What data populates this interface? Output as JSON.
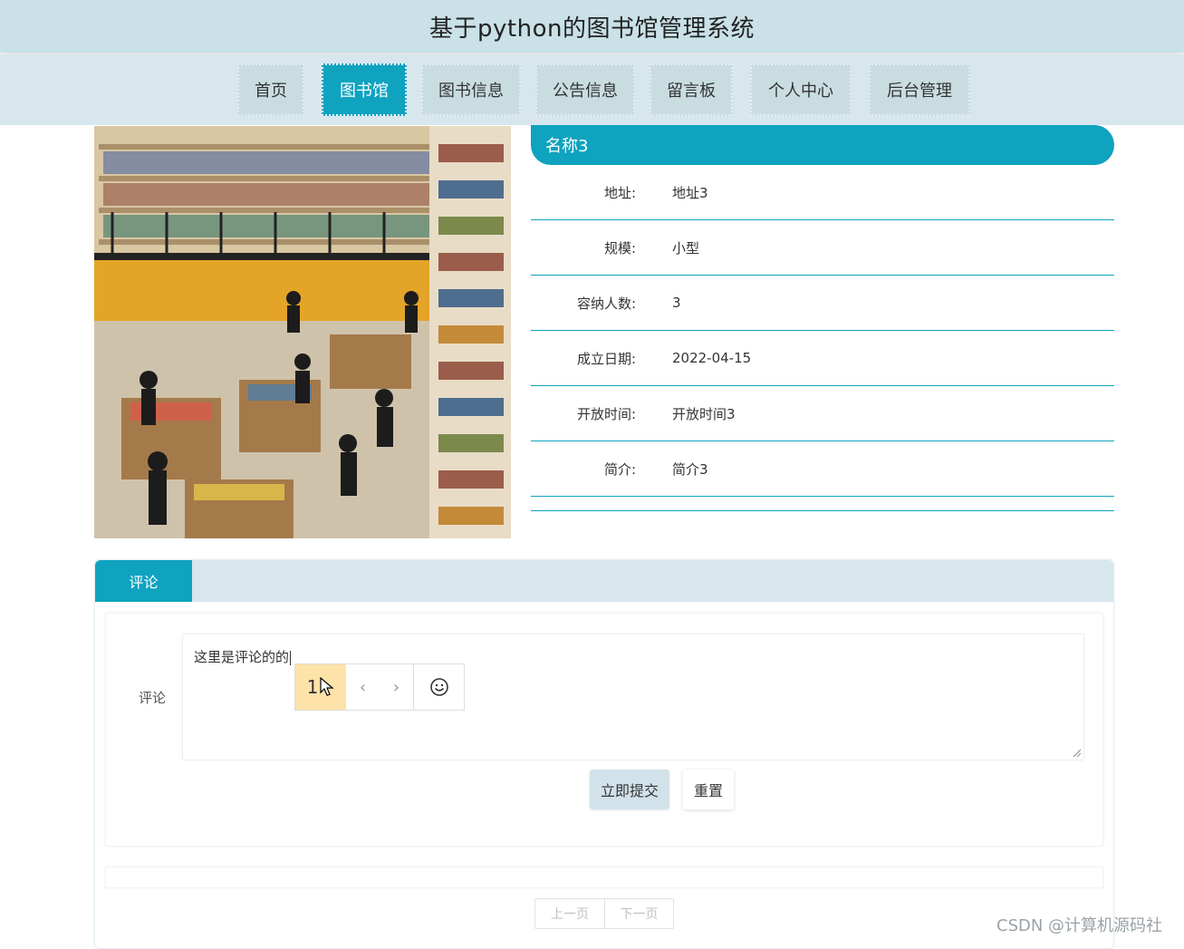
{
  "header": {
    "title": "基于python的图书馆管理系统"
  },
  "nav": {
    "items": [
      {
        "label": "首页",
        "active": false
      },
      {
        "label": "图书馆",
        "active": true
      },
      {
        "label": "图书信息",
        "active": false
      },
      {
        "label": "公告信息",
        "active": false
      },
      {
        "label": "留言板",
        "active": false
      },
      {
        "label": "个人中心",
        "active": false
      },
      {
        "label": "后台管理",
        "active": false
      }
    ]
  },
  "detail": {
    "name": "名称3",
    "fields": [
      {
        "label": "地址:",
        "value": "地址3"
      },
      {
        "label": "规模:",
        "value": "小型"
      },
      {
        "label": "容纳人数:",
        "value": "3"
      },
      {
        "label": "成立日期:",
        "value": "2022-04-15"
      },
      {
        "label": "开放时间:",
        "value": "开放时间3"
      },
      {
        "label": "简介:",
        "value": "简介3"
      }
    ]
  },
  "comments": {
    "tab_label": "评论",
    "form_label": "评论",
    "textarea_value": "这里是评论的的",
    "ime": {
      "candidate": "1",
      "prev": "‹",
      "next": "›"
    },
    "submit_label": "立即提交",
    "reset_label": "重置",
    "pager": {
      "prev_label": "上一页",
      "next_label": "下一页"
    }
  },
  "colors": {
    "accent": "#0fa3c0",
    "header_bg": "#c9e1e7",
    "nav_bg": "#d8e6ee"
  },
  "watermark": "CSDN @计算机源码社"
}
